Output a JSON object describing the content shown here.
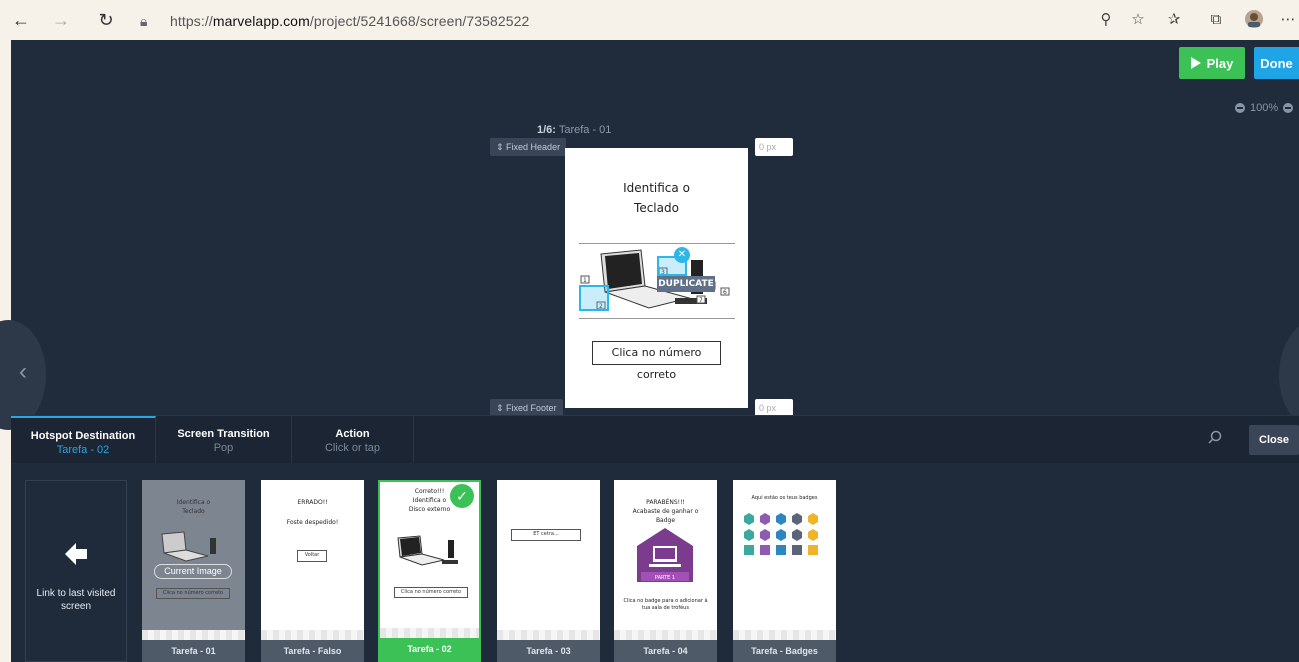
{
  "browser": {
    "url_prefix": "https://",
    "url_domain": "marvelapp.com",
    "url_path": "/project/5241668/screen/73582522",
    "icons": [
      "back-icon",
      "forward-icon",
      "refresh-icon",
      "lock-icon",
      "zoom-icon",
      "star-icon",
      "favorites-icon",
      "collections-icon",
      "profile-icon",
      "more-icon"
    ]
  },
  "toolbar": {
    "play_label": "Play",
    "done_label": "Done",
    "zoom_level": "100%"
  },
  "screen": {
    "counter": "1/6:",
    "name": "Tarefa - 01",
    "fixed_header_label": "⇕ Fixed Header",
    "fixed_footer_label": "⇕ Fixed Footer",
    "header_px_placeholder": "0 px",
    "footer_px_placeholder": "0 px",
    "title_line1": "Identifica o",
    "title_line2": "Teclado",
    "button_text": "Clica no número correto",
    "duplicate_label": "DUPLICATE",
    "callouts": [
      "1",
      "2",
      "3",
      "5",
      "6",
      "7"
    ]
  },
  "panel": {
    "tabs": [
      {
        "title": "Hotspot Destination",
        "value": "Tarefa - 02"
      },
      {
        "title": "Screen Transition",
        "value": "Pop"
      },
      {
        "title": "Action",
        "value": "Click or tap"
      }
    ],
    "close_label": "Close",
    "last_visited_label": "Link to last visited screen"
  },
  "thumbnails": [
    {
      "name": "Tarefa - 01",
      "line1": "Identifica o",
      "line2": "Teclado",
      "button": "Clica no número correto",
      "badge": "Current Image"
    },
    {
      "name": "Tarefa - Falso",
      "line1": "ERRADO!!",
      "line2": "Foste despedido!",
      "button": "Voltar"
    },
    {
      "name": "Tarefa - 02",
      "line1": "Correto!!!",
      "line2": "Identifica o",
      "line3": "Disco externo",
      "button": "Clica no número correto"
    },
    {
      "name": "Tarefa - 03",
      "button": "ET cetra..."
    },
    {
      "name": "Tarefa - 04",
      "line1": "PARABÉNS!!!",
      "line2": "Acabaste de ganhar o",
      "line3": "Badge",
      "ribbon": "PARTE 1",
      "caption": "Clica no badge para o adicionar à tua sala de troféus"
    },
    {
      "name": "Tarefa - Badges",
      "line1": "Aqui estão os teus badges"
    }
  ],
  "colors": {
    "accent_green": "#3bc156",
    "accent_blue": "#1fa5e6",
    "editor_bg": "#202b3b",
    "badge_purple": "#7b3c8e"
  }
}
